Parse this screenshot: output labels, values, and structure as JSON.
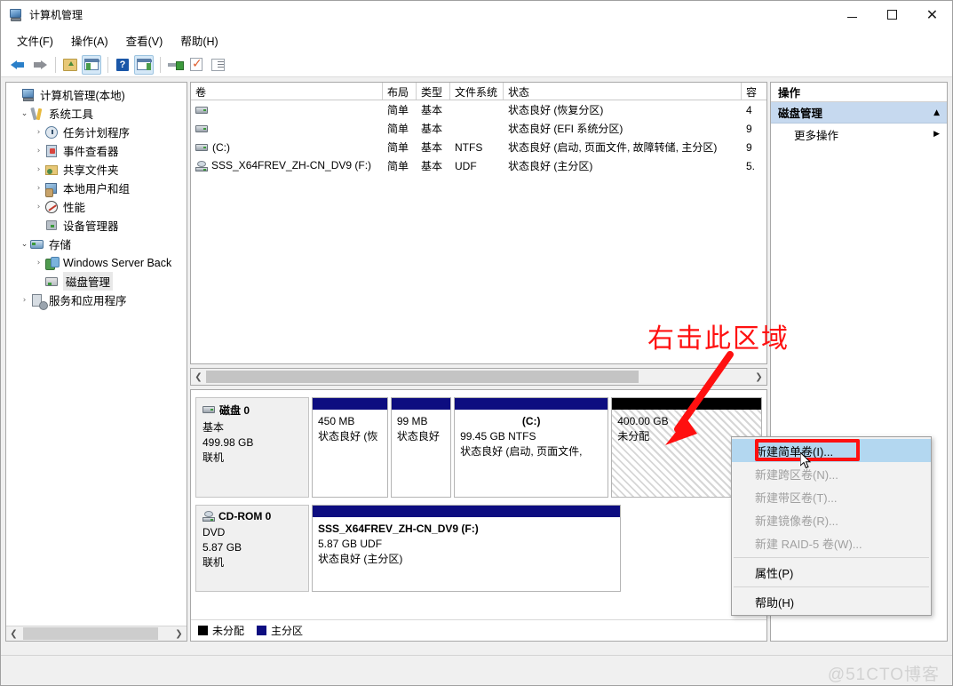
{
  "window": {
    "title": "计算机管理",
    "icon": "computer-management-icon",
    "minimize": "−",
    "maximize": "□",
    "close": "✕"
  },
  "menubar": {
    "items": [
      {
        "label": "文件(F)"
      },
      {
        "label": "操作(A)"
      },
      {
        "label": "查看(V)"
      },
      {
        "label": "帮助(H)"
      }
    ]
  },
  "toolbar": {
    "items": [
      {
        "name": "back-arrow-icon"
      },
      {
        "name": "forward-arrow-icon"
      },
      {
        "name": "up-folder-icon"
      },
      {
        "name": "show-console-tree-icon"
      },
      {
        "name": "help-icon",
        "glyph": "?"
      },
      {
        "name": "show-action-pane-icon"
      },
      {
        "name": "properties-icon"
      },
      {
        "name": "refresh-check-icon"
      },
      {
        "name": "list-view-icon"
      }
    ]
  },
  "tree": {
    "items": [
      {
        "label": "计算机管理(本地)",
        "indent": 0,
        "chevron": "",
        "icon": "computer-icon",
        "selected": false
      },
      {
        "label": "系统工具",
        "indent": 1,
        "chevron": "⌄",
        "icon": "system-tools-icon",
        "selected": false
      },
      {
        "label": "任务计划程序",
        "indent": 2,
        "chevron": "›",
        "icon": "task-scheduler-icon",
        "selected": false
      },
      {
        "label": "事件查看器",
        "indent": 2,
        "chevron": "›",
        "icon": "event-viewer-icon",
        "selected": false
      },
      {
        "label": "共享文件夹",
        "indent": 2,
        "chevron": "›",
        "icon": "shared-folders-icon",
        "selected": false
      },
      {
        "label": "本地用户和组",
        "indent": 2,
        "chevron": "›",
        "icon": "local-users-icon",
        "selected": false
      },
      {
        "label": "性能",
        "indent": 2,
        "chevron": "›",
        "icon": "performance-icon",
        "selected": false
      },
      {
        "label": "设备管理器",
        "indent": 2,
        "chevron": "",
        "icon": "device-manager-icon",
        "selected": false
      },
      {
        "label": "存储",
        "indent": 1,
        "chevron": "⌄",
        "icon": "storage-icon",
        "selected": false
      },
      {
        "label": "Windows Server Back",
        "indent": 2,
        "chevron": "›",
        "icon": "backup-icon",
        "selected": false
      },
      {
        "label": "磁盘管理",
        "indent": 2,
        "chevron": "",
        "icon": "disk-management-icon",
        "selected": true
      },
      {
        "label": "服务和应用程序",
        "indent": 1,
        "chevron": "›",
        "icon": "services-icon",
        "selected": false
      }
    ]
  },
  "volume_list": {
    "columns": [
      "卷",
      "布局",
      "类型",
      "文件系统",
      "状态",
      "容"
    ],
    "rows": [
      {
        "icon": "hard-disk-icon",
        "volume": "",
        "layout": "简单",
        "type": "基本",
        "filesystem": "",
        "status": "状态良好 (恢复分区)",
        "capacity": "4"
      },
      {
        "icon": "hard-disk-icon",
        "volume": "",
        "layout": "简单",
        "type": "基本",
        "filesystem": "",
        "status": "状态良好 (EFI 系统分区)",
        "capacity": "9"
      },
      {
        "icon": "hard-disk-icon",
        "volume": "(C:)",
        "layout": "简单",
        "type": "基本",
        "filesystem": "NTFS",
        "status": "状态良好 (启动, 页面文件, 故障转储, 主分区)",
        "capacity": "9"
      },
      {
        "icon": "cd-rom-icon",
        "volume": "SSS_X64FREV_ZH-CN_DV9 (F:)",
        "layout": "简单",
        "type": "基本",
        "filesystem": "UDF",
        "status": "状态良好 (主分区)",
        "capacity": "5."
      }
    ]
  },
  "graphical_view": {
    "disks": [
      {
        "name": "磁盘 0",
        "icon": "hard-disk-icon",
        "type": "基本",
        "size": "499.98 GB",
        "status": "联机",
        "partitions": [
          {
            "bar_color": "#0d0d80",
            "flex": 95,
            "title": "",
            "size": "450 MB",
            "status": "状态良好 (恢",
            "kind": "primary"
          },
          {
            "bar_color": "#0d0d80",
            "flex": 75,
            "title": "",
            "size": "99 MB",
            "status": "状态良好",
            "kind": "primary"
          },
          {
            "bar_color": "#0d0d80",
            "flex": 195,
            "title": "(C:)",
            "size": "99.45 GB NTFS",
            "status": "状态良好 (启动, 页面文件,",
            "kind": "primary"
          },
          {
            "bar_color": "#000000",
            "flex": 190,
            "title": "",
            "size": "400.00 GB",
            "status": "未分配",
            "kind": "unallocated"
          }
        ]
      },
      {
        "name": "CD-ROM 0",
        "icon": "cd-rom-icon",
        "type": "DVD",
        "size": "5.87 GB",
        "status": "联机",
        "partitions": [
          {
            "bar_color": "#0d0d80",
            "flex": 340,
            "title": "SSS_X64FREV_ZH-CN_DV9  (F:)",
            "size": "5.87 GB UDF",
            "status": "状态良好 (主分区)",
            "kind": "primary"
          }
        ]
      }
    ],
    "legend": [
      {
        "label": "未分配",
        "color": "#000000"
      },
      {
        "label": "主分区",
        "color": "#0d0d80"
      }
    ]
  },
  "actions_pane": {
    "header": "操作",
    "group_label": "磁盘管理",
    "group_caret": "▲",
    "items": [
      {
        "label": "更多操作",
        "submenu_arrow": "▶"
      }
    ]
  },
  "context_menu": {
    "items": [
      {
        "label": "新建简单卷(I)...",
        "state": "highlighted"
      },
      {
        "label": "新建跨区卷(N)...",
        "state": "disabled"
      },
      {
        "label": "新建带区卷(T)...",
        "state": "disabled"
      },
      {
        "label": "新建镜像卷(R)...",
        "state": "disabled"
      },
      {
        "label": "新建 RAID-5 卷(W)...",
        "state": "disabled"
      },
      {
        "label": "属性(P)",
        "state": "normal",
        "separator_before": true
      },
      {
        "label": "帮助(H)",
        "state": "normal",
        "separator_before": true
      }
    ]
  },
  "annotations": {
    "text": "右击此区域",
    "text_color": "#ff1010",
    "arrow_color": "#ff1010",
    "highlight_box_color": "#ff1010"
  },
  "statusbar": {
    "watermark": "@51CTO博客"
  }
}
